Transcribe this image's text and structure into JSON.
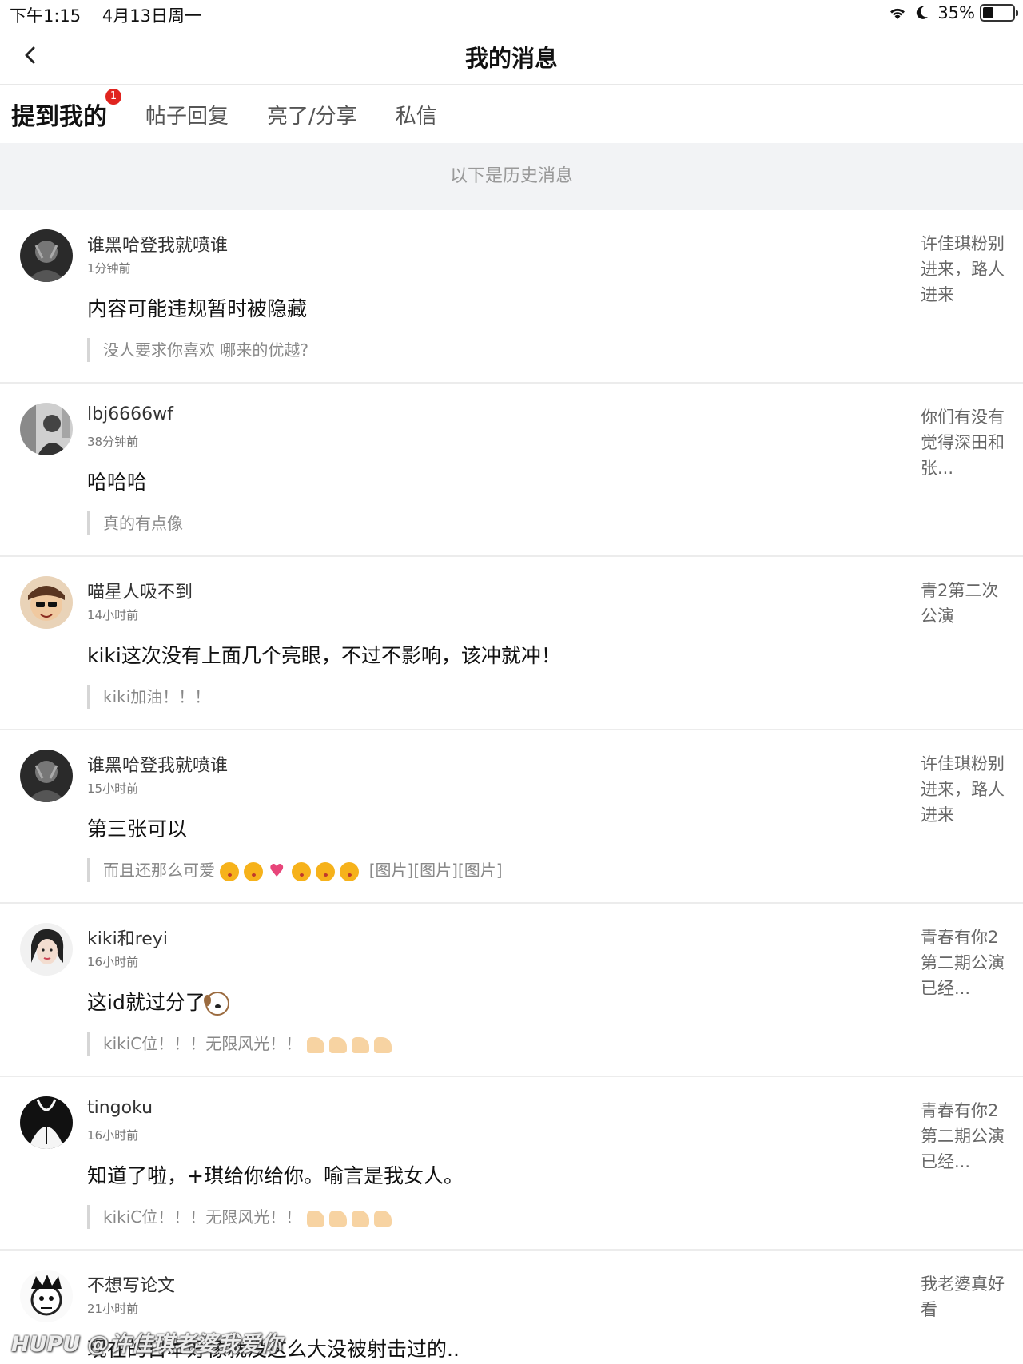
{
  "status_bar": {
    "time": "下午1:15",
    "date": "4月13日周一",
    "battery": "35%",
    "battery_level": 0.35,
    "icons": [
      "wifi-icon",
      "moon-icon",
      "battery-icon"
    ]
  },
  "nav": {
    "title": "我的消息",
    "back_icon": "chevron-left-icon"
  },
  "tabs": [
    {
      "label": "提到我的",
      "active": true,
      "badge": "1"
    },
    {
      "label": "帖子回复",
      "active": false
    },
    {
      "label": "亮了/分享",
      "active": false
    },
    {
      "label": "私信",
      "active": false
    }
  ],
  "banner": "以下是历史消息",
  "messages": [
    {
      "user": "谁黑哈登我就喷谁",
      "time": "1分钟前",
      "content": "内容可能违规暂时被隐藏",
      "quote": "没人要求你喜欢 哪来的优越?",
      "source": "许佳琪粉别进来，路人进来"
    },
    {
      "user": "lbj6666wf",
      "time": "38分钟前",
      "content": "哈哈哈",
      "quote": "真的有点像",
      "source": "你们有没有觉得深田和张..."
    },
    {
      "user": "喵星人吸不到",
      "time": "14小时前",
      "content": "kiki这次没有上面几个亮眼，不过不影响，该冲就冲！",
      "quote": "kiki加油！！！",
      "source": "青2第二次公演"
    },
    {
      "user": "谁黑哈登我就喷谁",
      "time": "15小时前",
      "content": "第三张可以",
      "quote": "而且还那么可爱",
      "quote_suffix": "[图片][图片][图片]",
      "source": "许佳琪粉别进来，路人进来"
    },
    {
      "user": "kiki和reyi",
      "time": "16小时前",
      "content": "这id就过分了",
      "quote": "kikiC位！！！无限风光！！",
      "source": "青春有你2第二期公演已经..."
    },
    {
      "user": "tingoku",
      "time": "16小时前",
      "content": "知道了啦，+琪给你给你。喻言是我女人。",
      "quote": "kikiC位！！！无限风光！！",
      "source": "青春有你2第二期公演已经..."
    },
    {
      "user": "不想写论文",
      "time": "21小时前",
      "content": "现在的日本好像就没这么大没被射击过的..",
      "source": "我老婆真好看"
    }
  ],
  "watermark": "HUPU @许佳琪老婆我爱你"
}
